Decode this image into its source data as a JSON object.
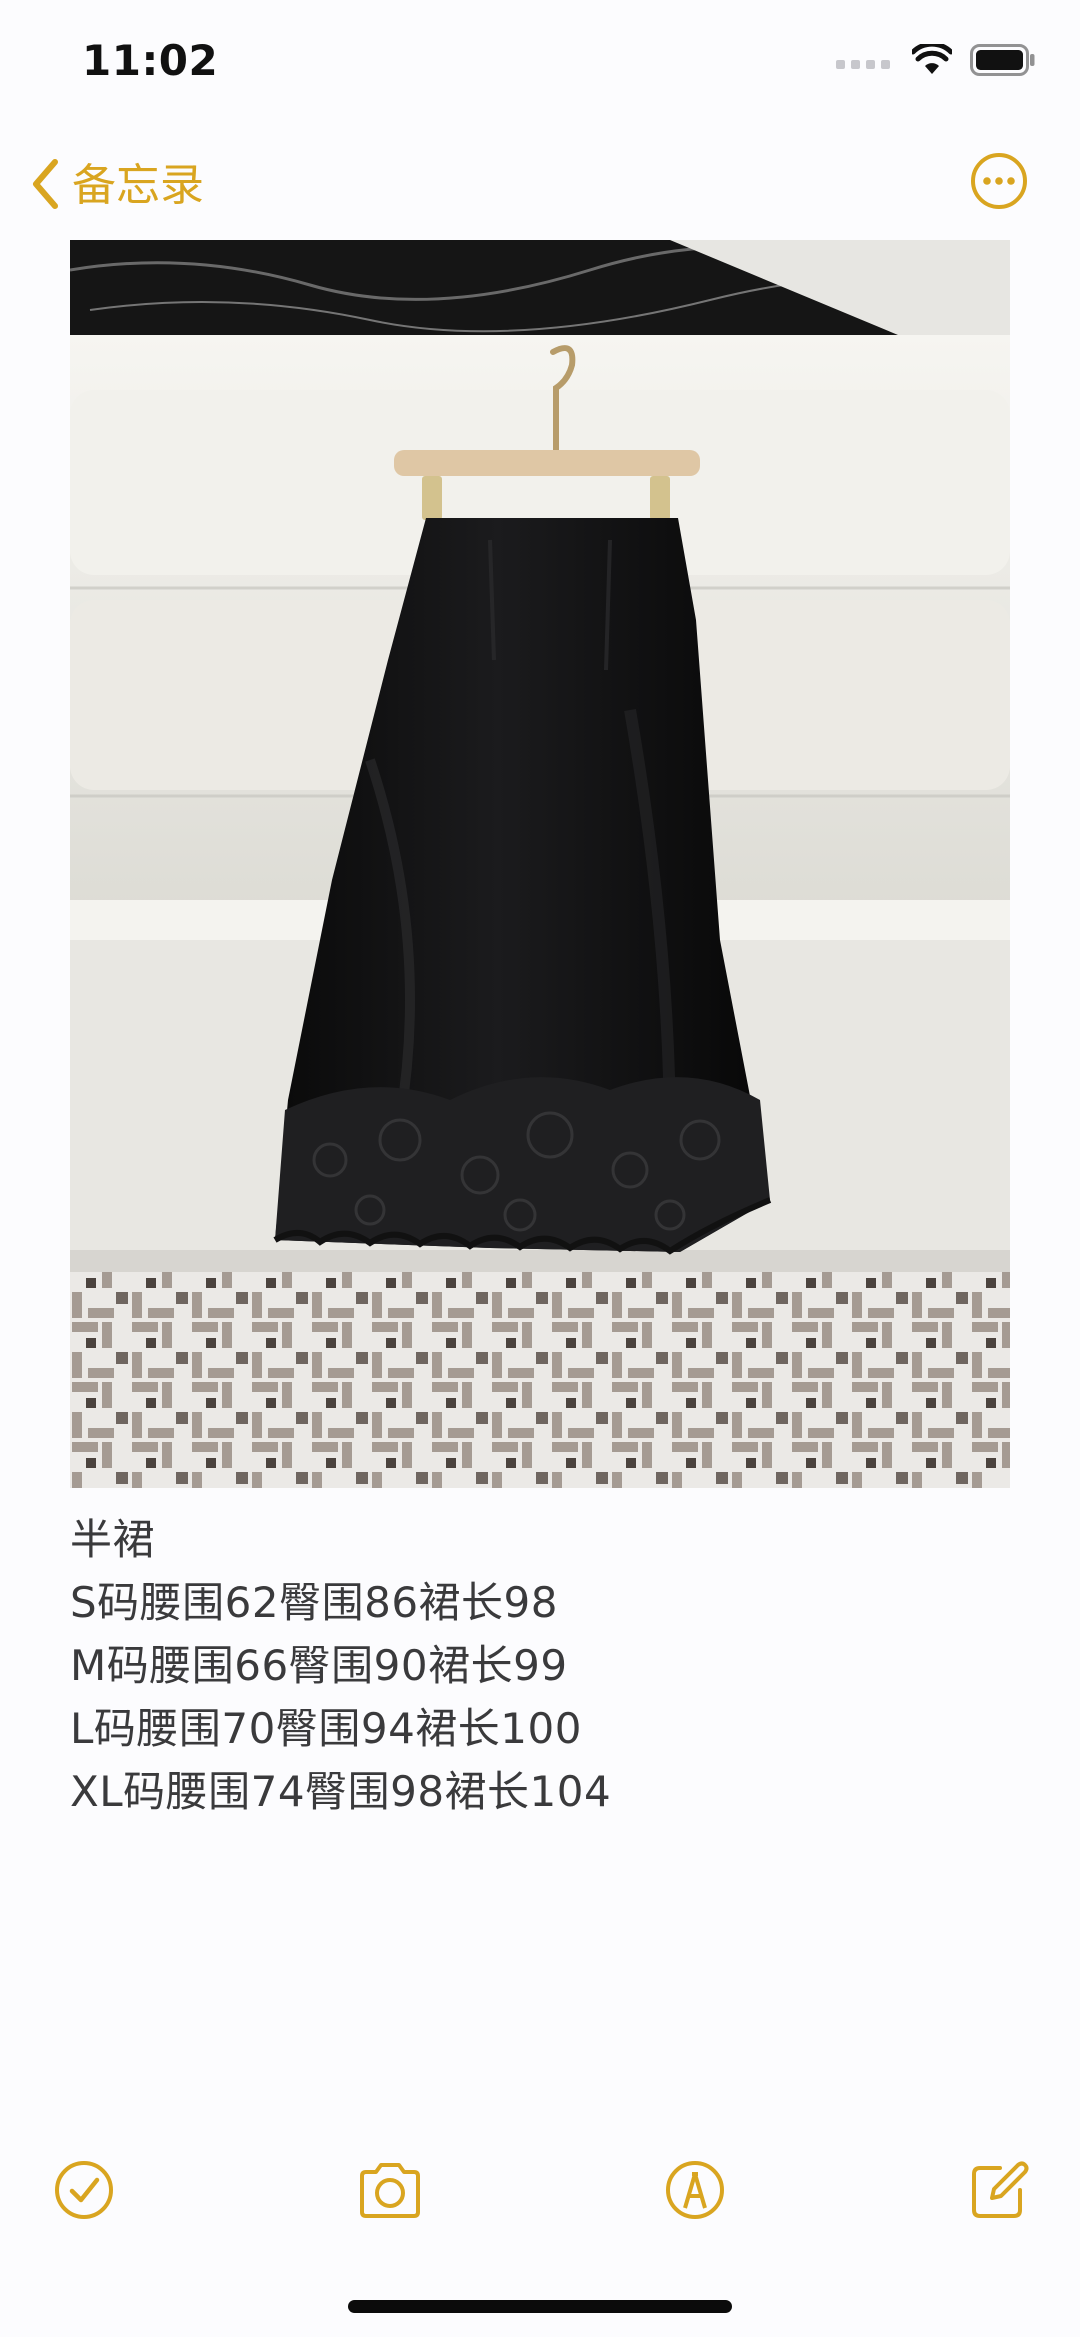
{
  "status_bar": {
    "time": "11:02",
    "icons": [
      "cellular-signal-icon",
      "wifi-icon",
      "battery-icon"
    ]
  },
  "nav": {
    "back_label": "备忘录",
    "back_icon": "chevron-left-icon",
    "more_icon": "ellipsis-circle-icon"
  },
  "note": {
    "image_alt": "black satin midi skirt with lace hem on hanger",
    "lines": [
      "半裙",
      "S码腰围62臀围86裙长98",
      "M码腰围66臀围90裙长99",
      "L码腰围70臀围94裙长100",
      "XL码腰围74臀围98裙长104"
    ]
  },
  "toolbar": {
    "icons": [
      "checklist-icon",
      "camera-icon",
      "markup-pen-icon",
      "compose-icon"
    ]
  },
  "colors": {
    "accent": "#d9a520",
    "text": "#3a3a3c",
    "background": "#fcfcfe"
  }
}
